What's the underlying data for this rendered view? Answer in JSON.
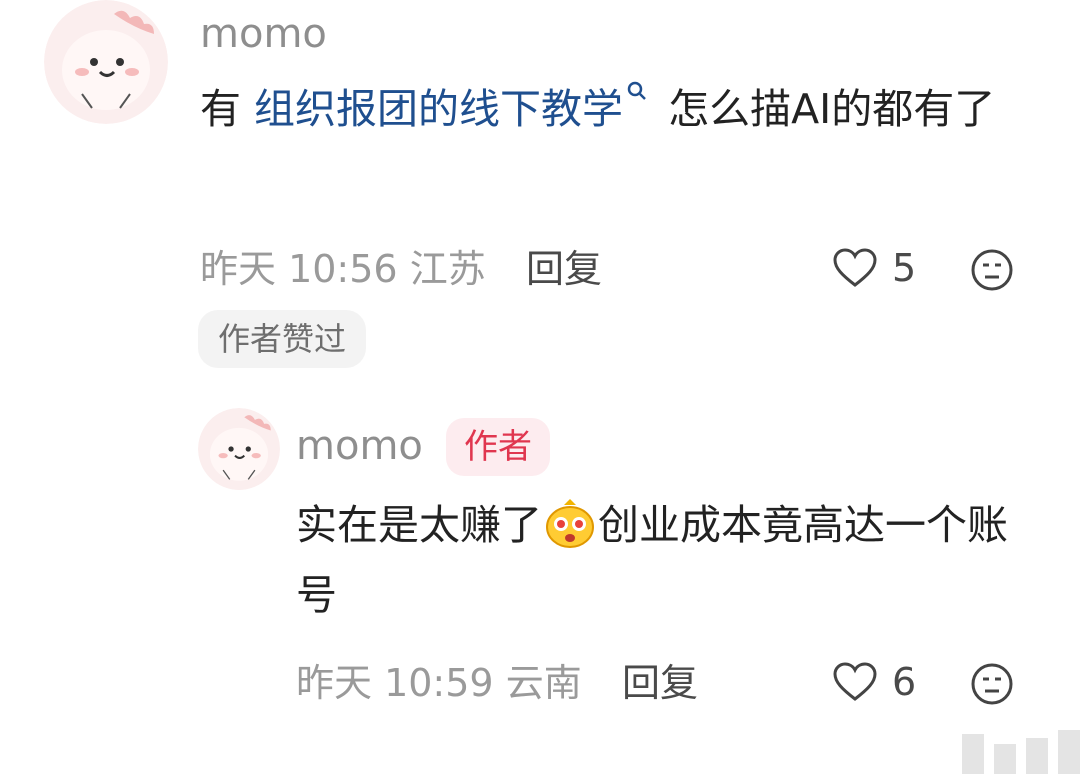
{
  "comment": {
    "username": "momo",
    "text_before": "有 ",
    "link_text": "组织报团的线下教学",
    "text_after": " 怎么描AI的都有了",
    "time": "昨天 10:56",
    "location": "江苏",
    "reply_label": "回复",
    "like_count": "5",
    "liked_by_author_label": "作者赞过",
    "icons": {
      "avatar": "cute-dinosaur-avatar",
      "search": "search-icon",
      "like": "heart-icon",
      "dislike": "meh-face-icon"
    }
  },
  "reply": {
    "username": "momo",
    "author_badge": "作者",
    "text_before": "实在是太赚了",
    "text_after": "创业成本竟高达一个账号",
    "time": "昨天 10:59",
    "location": "云南",
    "reply_label": "回复",
    "like_count": "6",
    "icons": {
      "avatar": "cute-dinosaur-avatar",
      "emoji": "shocked-money-eyes-emoji",
      "like": "heart-icon",
      "dislike": "meh-face-icon"
    }
  },
  "colors": {
    "link": "#1f4f8f",
    "author_badge_bg": "#fdecef",
    "author_badge_text": "#e0364f",
    "meta_gray": "#9a9a9a"
  }
}
